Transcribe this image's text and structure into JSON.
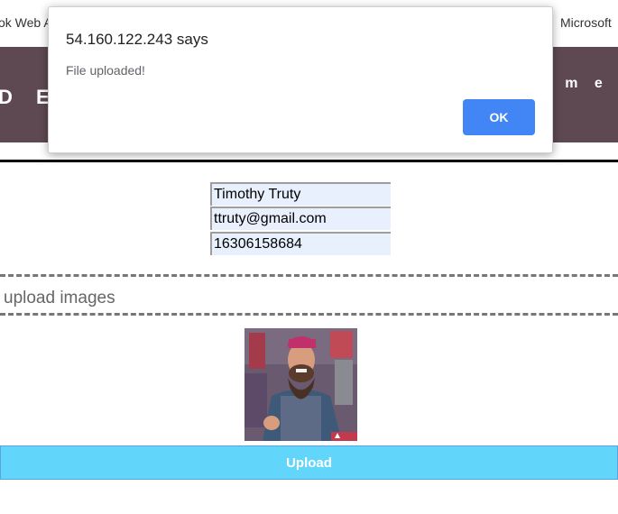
{
  "bookmarks": {
    "left_item": "ok Web A",
    "right_item": "Microsoft"
  },
  "header": {
    "logo_text": "D E R",
    "nav_item": "o m e"
  },
  "form": {
    "name_value": "Timothy Truty",
    "email_value": "ttruty@gmail.com",
    "phone_value": "16306158684"
  },
  "upload": {
    "drop_label": "upload images",
    "button_label": "Upload"
  },
  "dialog": {
    "title": "54.160.122.243 says",
    "message": "File uploaded!",
    "ok_label": "OK"
  },
  "colors": {
    "header_bg": "#5e4952",
    "upload_button_bg": "#62d6fa",
    "dialog_ok_bg": "#4285f4",
    "field_bg": "#e8f0fe"
  }
}
